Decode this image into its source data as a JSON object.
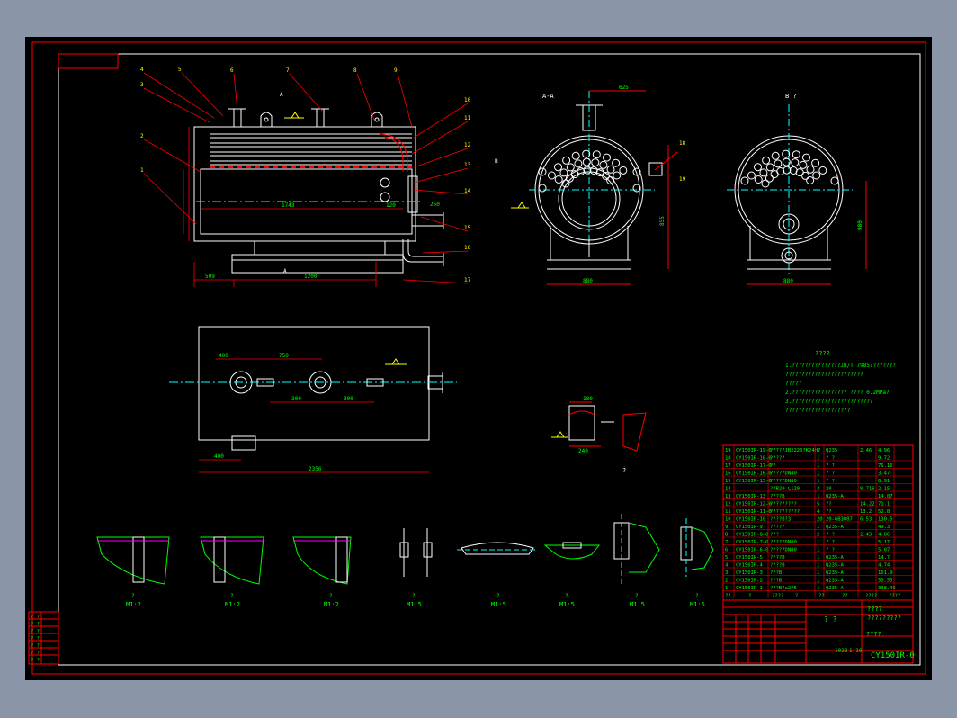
{
  "app": {
    "background": "#8a96a8",
    "viewport_bg": "#000000"
  },
  "colors": {
    "frame": "#ff0000",
    "outline": "#ffffff",
    "dim": "#ff0000",
    "text": "#00ff00",
    "center": "#00ffff",
    "hidden": "#ffff00",
    "hatch": "#ff00ff",
    "leader": "#ff0000",
    "label": "#ffff00",
    "table": "#ff0000",
    "table_text": "#00ff00"
  },
  "views": {
    "main_front": {
      "label_a_top": "A",
      "label_a_bottom": "A",
      "label_b": "B",
      "dims": {
        "d1": "1743",
        "d2": "120",
        "d3": "250",
        "d4": "509",
        "d5": "1200",
        "d6": "100",
        "d7": "50"
      },
      "callouts": [
        "1",
        "2",
        "3",
        "4",
        "5",
        "6",
        "7",
        "8",
        "9",
        "10",
        "11",
        "12",
        "13",
        "14",
        "15",
        "16",
        "17"
      ]
    },
    "section_aa": {
      "title": "A-A",
      "dim_top": "625",
      "dim_bottom": "880",
      "dim_right": "855"
    },
    "view_b": {
      "title": "B ?",
      "dim_bottom": "880",
      "dim_right": "980"
    },
    "plan_view": {
      "dims": {
        "d1": "400",
        "d2": "750",
        "d3": "300",
        "d4": "300",
        "d5": "400",
        "d6": "2356"
      }
    },
    "detail_small": {
      "dim1": "180",
      "dim2": "240",
      "label": "?"
    },
    "details": [
      {
        "label": "?",
        "scale": "M1:2"
      },
      {
        "label": "?",
        "scale": "M1:2"
      },
      {
        "label": "?",
        "scale": "M1:2"
      },
      {
        "label": "?",
        "scale": "M1:5"
      },
      {
        "label": "?",
        "scale": "M1:5"
      },
      {
        "label": "?",
        "scale": "M1:5"
      },
      {
        "label": "?",
        "scale": "M1:5"
      },
      {
        "label": "?",
        "scale": "M1:5"
      }
    ]
  },
  "notes": {
    "title": "????",
    "lines": [
      "1.???????????????JB/T 7985????????",
      "  ????????????????????????",
      "  ?????",
      "2.?????????????????   ????  0.2MPa?",
      "3.?????????????????????????",
      "  ????????????????????"
    ]
  },
  "bom": {
    "rows": [
      [
        "19",
        "CY150IR-19-0",
        "?????JB2220?K24H?",
        "1",
        "Q235",
        "2.46",
        "4.96"
      ],
      [
        "18",
        "CY150IR-18-0",
        "?????",
        "1",
        "? ?",
        "",
        "9.72"
      ],
      [
        "17",
        "CY150IR-17-0",
        "??",
        "1",
        "? ?",
        "",
        "76.16"
      ],
      [
        "16",
        "CY150IR-16-0",
        "?????DN40",
        "1",
        "? ?",
        "",
        "3.47"
      ],
      [
        "15",
        "CY150IR-15-0",
        "?????DN80",
        "1",
        "? ?",
        "",
        "6.91"
      ],
      [
        "14",
        "",
        "??B20 L129",
        "3",
        "20",
        "0.716",
        "2.15"
      ],
      [
        "13",
        "CY150IR-13",
        "????B",
        "1",
        "Q235-A",
        "",
        "14.07"
      ],
      [
        "12",
        "CY150IR-12-0",
        "?????????",
        "5",
        "??",
        "14.22",
        "71.1"
      ],
      [
        "11",
        "CY150IR-11-0",
        "??????????",
        "4",
        "??",
        "13.2",
        "52.8"
      ],
      [
        "10",
        "CY150IR-10",
        "????B?3",
        "20",
        "20-GB3087",
        "6.53",
        "130.5"
      ],
      [
        "9",
        "CY150IR-9",
        "?????",
        "1",
        "Q235-A",
        "",
        "49.3"
      ],
      [
        "8",
        "CY150IR-8-0",
        "???",
        "2",
        "? ?",
        "2.43",
        "4.86"
      ],
      [
        "7",
        "CY150IR-7-0",
        "?????DN80",
        "1",
        "? ?",
        "",
        "5.17"
      ],
      [
        "6",
        "CY150IR-6-0",
        "?????DN80",
        "1",
        "? ?",
        "",
        "5.07"
      ],
      [
        "5",
        "CY150IR-5",
        "????B",
        "1",
        "Q235-A",
        "",
        "14.7"
      ],
      [
        "4",
        "CY150IR-4",
        "????B",
        "1",
        "Q235-A",
        "",
        "4.74"
      ],
      [
        "3",
        "CY150IR-3",
        "???B",
        "1",
        "Q235-A",
        "",
        "161.9"
      ],
      [
        "2",
        "CY150IR-2",
        "???B",
        "1",
        "Q235-A",
        "",
        "53.55"
      ],
      [
        "1",
        "CY150IR-1",
        "???B?a2?5",
        "1",
        "Q235-A",
        "",
        "338.46"
      ]
    ],
    "header": [
      "??",
      "?",
      "????",
      "?",
      "??",
      "??",
      "????",
      "????"
    ],
    "title_block": {
      "name": "? ?",
      "company": "????\n?????????",
      "drawing_no": "CY150IR-0",
      "scale": "1:10",
      "weight": "1028",
      "unit": "????",
      "sheet_cells": [
        "?",
        "?",
        "?",
        "?"
      ]
    }
  },
  "rev_block": {
    "rows": [
      "? ?",
      "? ?",
      "? ?",
      "? ?",
      "? ?",
      "? ?",
      "? ?"
    ]
  }
}
